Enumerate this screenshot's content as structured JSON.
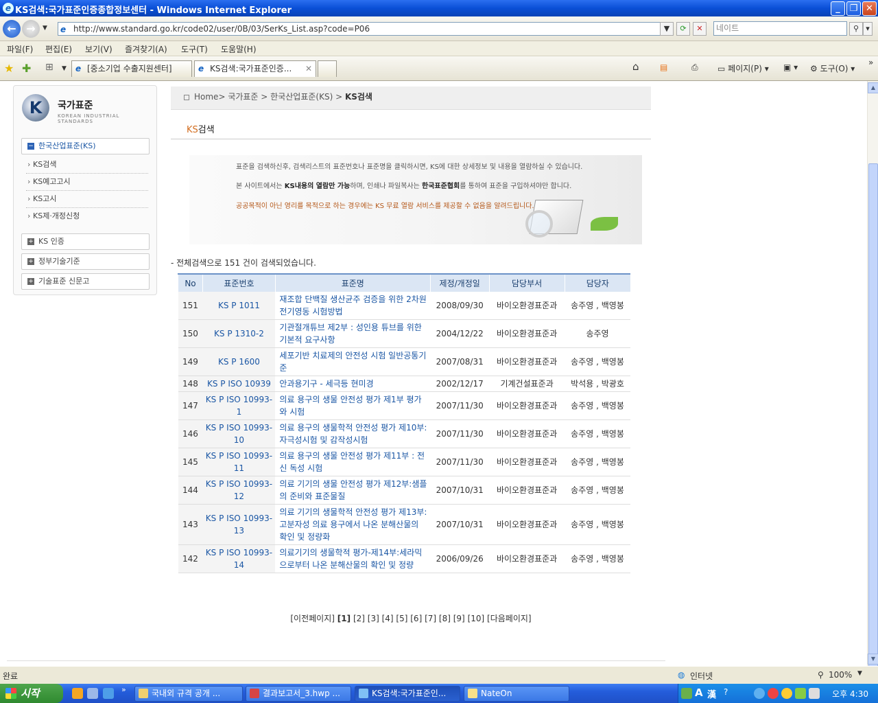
{
  "window": {
    "title": "KS검색:국가표준인증종합정보센터 - Windows Internet Explorer"
  },
  "address": {
    "url": "http://www.standard.go.kr/code02/user/0B/03/SerKs_List.asp?code=P06",
    "search_placeholder": "네이트"
  },
  "menu": [
    "파일(F)",
    "편집(E)",
    "보기(V)",
    "즐겨찾기(A)",
    "도구(T)",
    "도움말(H)"
  ],
  "tabs": [
    {
      "label": "[중소기업 수출지원센터]"
    },
    {
      "label": "KS검색:국가표준인증..."
    }
  ],
  "toolbar_right": {
    "page": "페이지(P)",
    "tools": "도구(O)"
  },
  "sidebar": {
    "logo_title": "국가표준",
    "logo_subtitle": "KOREAN INDUSTRIAL STANDARDS",
    "section_active": "한국산업표준(KS)",
    "sub_items": [
      "KS검색",
      "KS예고고시",
      "KS고시",
      "KS제·개정신청"
    ],
    "sections": [
      "KS 인증",
      "정부기술기준",
      "기술표준 신문고"
    ]
  },
  "breadcrumb": {
    "home": "Home",
    "items": [
      "국가표준",
      "한국산업표준(KS)",
      "KS검색"
    ]
  },
  "page_title": {
    "prefix": "KS",
    "rest": "검색"
  },
  "banner": {
    "line1": "표준을 검색하신후, 검색리스트의 표준번호나 표준명을 클릭하시면,   KS에 대한 상세정보 및 내용을 열람하실 수 있습니다.",
    "line2_a": "본 사이트에서는 ",
    "line2_b": "KS내용의 열람만 가능",
    "line2_c": "하며, 인쇄나 파일복사는 ",
    "line2_d": "한국표준협회",
    "line2_e": "를 통하여 표준을 구입하셔야만 합니다.",
    "line3": "공공목적이 아닌 영리를 목적으로 하는 경우에는   KS 무료 열람 서비스를 제공할 수 없음을 알려드립니다."
  },
  "summary": "- 전체검색으로 151 건이 검색되었습니다.",
  "table": {
    "headers": [
      "No",
      "표준번호",
      "표준명",
      "제정/개정일",
      "담당부서",
      "담당자"
    ],
    "rows": [
      {
        "no": "151",
        "code": "KS P 1011",
        "name": "재조합 단백질 생산균주 검증을 위한 2차원 전기영동 시험방법",
        "date": "2008/09/30",
        "dept": "바이오환경표준과",
        "person": "송주영 , 백영봉"
      },
      {
        "no": "150",
        "code": "KS P 1310-2",
        "name": "기관절개튜브 제2부 : 성인용 튜브를 위한 기본적 요구사항",
        "date": "2004/12/22",
        "dept": "바이오환경표준과",
        "person": "송주영"
      },
      {
        "no": "149",
        "code": "KS P 1600",
        "name": "세포기반 치료제의 안전성 시험 일반공통기준",
        "date": "2007/08/31",
        "dept": "바이오환경표준과",
        "person": "송주영 , 백영봉"
      },
      {
        "no": "148",
        "code": "KS P ISO 10939",
        "name": "안과용기구 - 세극등 현미경",
        "date": "2002/12/17",
        "dept": "기계건설표준과",
        "person": "박석용 , 박광호"
      },
      {
        "no": "147",
        "code": "KS P ISO 10993-1",
        "name": "의료 용구의 생물 안전성 평가 제1부 평가와 시험",
        "date": "2007/11/30",
        "dept": "바이오환경표준과",
        "person": "송주영 , 백영봉"
      },
      {
        "no": "146",
        "code": "KS P ISO 10993-10",
        "name": "의료 용구의 생물학적 안전성 평가 제10부:자극성시험 및 감작성시험",
        "date": "2007/11/30",
        "dept": "바이오환경표준과",
        "person": "송주영 , 백영봉"
      },
      {
        "no": "145",
        "code": "KS P ISO 10993-11",
        "name": "의료 용구의 생물 안전성 평가 제11부 : 전신 독성 시험",
        "date": "2007/11/30",
        "dept": "바이오환경표준과",
        "person": "송주영 , 백영봉"
      },
      {
        "no": "144",
        "code": "KS P ISO 10993-12",
        "name": "의료 기기의 생물 안전성 평가 제12부:샘플의 준비와 표준물질",
        "date": "2007/10/31",
        "dept": "바이오환경표준과",
        "person": "송주영 , 백영봉"
      },
      {
        "no": "143",
        "code": "KS P ISO 10993-13",
        "name": "의료 기기의 생물학적 안전성 평가 제13부:고분자성 의료 용구에서 나온 분해산물의 확인 및 정량화",
        "date": "2007/10/31",
        "dept": "바이오환경표준과",
        "person": "송주영 , 백영봉"
      },
      {
        "no": "142",
        "code": "KS P ISO 10993-14",
        "name": "의료기기의 생물학적 평가-제14부:세라믹으로부터 나온 분해산물의 확인 및 정량",
        "date": "2006/09/26",
        "dept": "바이오환경표준과",
        "person": "송주영 , 백영봉"
      }
    ]
  },
  "pager": {
    "prev": "[이전페이지]",
    "current": "[1]",
    "pages": [
      "[2]",
      "[3]",
      "[4]",
      "[5]",
      "[6]",
      "[7]",
      "[8]",
      "[9]",
      "[10]"
    ],
    "next": "[다음페이지]"
  },
  "statusbar": {
    "status": "완료",
    "zone": "인터넷",
    "zoom": "100%"
  },
  "taskbar": {
    "start": "시작",
    "tasks": [
      "국내외 규격 공개 ...",
      "결과보고서_3.hwp ...",
      "KS검색:국가표준인...",
      "NateOn"
    ],
    "clock": "오후 4:30"
  }
}
